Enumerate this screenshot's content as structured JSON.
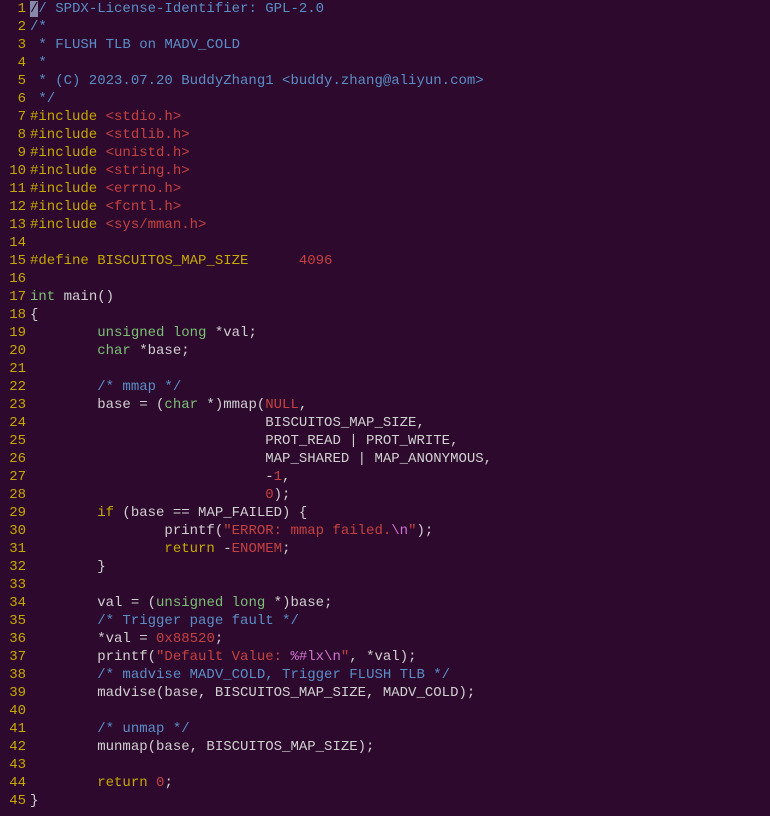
{
  "lines": [
    {
      "n": "1",
      "segs": [
        {
          "cls": "cursor",
          "t": "/"
        },
        {
          "cls": "comment",
          "t": "/ SPDX-License-Identifier: GPL-2.0"
        }
      ]
    },
    {
      "n": "2",
      "segs": [
        {
          "cls": "comment",
          "t": "/*"
        }
      ]
    },
    {
      "n": "3",
      "segs": [
        {
          "cls": "comment",
          "t": " * FLUSH TLB on MADV_COLD"
        }
      ]
    },
    {
      "n": "4",
      "segs": [
        {
          "cls": "comment",
          "t": " *"
        }
      ]
    },
    {
      "n": "5",
      "segs": [
        {
          "cls": "comment",
          "t": " * (C) 2023.07.20 BuddyZhang1 <buddy.zhang@aliyun.com>"
        }
      ]
    },
    {
      "n": "6",
      "segs": [
        {
          "cls": "comment",
          "t": " */"
        }
      ]
    },
    {
      "n": "7",
      "segs": [
        {
          "cls": "keyword",
          "t": "#include "
        },
        {
          "cls": "string",
          "t": "<stdio.h>"
        }
      ]
    },
    {
      "n": "8",
      "segs": [
        {
          "cls": "keyword",
          "t": "#include "
        },
        {
          "cls": "string",
          "t": "<stdlib.h>"
        }
      ]
    },
    {
      "n": "9",
      "segs": [
        {
          "cls": "keyword",
          "t": "#include "
        },
        {
          "cls": "string",
          "t": "<unistd.h>"
        }
      ]
    },
    {
      "n": "10",
      "segs": [
        {
          "cls": "keyword",
          "t": "#include "
        },
        {
          "cls": "string",
          "t": "<string.h>"
        }
      ]
    },
    {
      "n": "11",
      "segs": [
        {
          "cls": "keyword",
          "t": "#include "
        },
        {
          "cls": "string",
          "t": "<errno.h>"
        }
      ]
    },
    {
      "n": "12",
      "segs": [
        {
          "cls": "keyword",
          "t": "#include "
        },
        {
          "cls": "string",
          "t": "<fcntl.h>"
        }
      ]
    },
    {
      "n": "13",
      "segs": [
        {
          "cls": "keyword",
          "t": "#include "
        },
        {
          "cls": "string",
          "t": "<sys/mman.h>"
        }
      ]
    },
    {
      "n": "14",
      "segs": [
        {
          "cls": "",
          "t": ""
        }
      ]
    },
    {
      "n": "15",
      "segs": [
        {
          "cls": "keyword",
          "t": "#define BISCUITOS_MAP_SIZE      "
        },
        {
          "cls": "number",
          "t": "4096"
        }
      ]
    },
    {
      "n": "16",
      "segs": [
        {
          "cls": "",
          "t": ""
        }
      ]
    },
    {
      "n": "17",
      "segs": [
        {
          "cls": "type",
          "t": "int"
        },
        {
          "cls": "ident",
          "t": " main()"
        }
      ]
    },
    {
      "n": "18",
      "segs": [
        {
          "cls": "ident",
          "t": "{"
        }
      ]
    },
    {
      "n": "19",
      "segs": [
        {
          "cls": "ident",
          "t": "        "
        },
        {
          "cls": "type",
          "t": "unsigned"
        },
        {
          "cls": "ident",
          "t": " "
        },
        {
          "cls": "type",
          "t": "long"
        },
        {
          "cls": "ident",
          "t": " *val;"
        }
      ]
    },
    {
      "n": "20",
      "segs": [
        {
          "cls": "ident",
          "t": "        "
        },
        {
          "cls": "type",
          "t": "char"
        },
        {
          "cls": "ident",
          "t": " *base;"
        }
      ]
    },
    {
      "n": "21",
      "segs": [
        {
          "cls": "",
          "t": ""
        }
      ]
    },
    {
      "n": "22",
      "segs": [
        {
          "cls": "ident",
          "t": "        "
        },
        {
          "cls": "comment",
          "t": "/* mmap */"
        }
      ]
    },
    {
      "n": "23",
      "segs": [
        {
          "cls": "ident",
          "t": "        base = ("
        },
        {
          "cls": "type",
          "t": "char"
        },
        {
          "cls": "ident",
          "t": " *)mmap("
        },
        {
          "cls": "number",
          "t": "NULL"
        },
        {
          "cls": "ident",
          "t": ","
        }
      ]
    },
    {
      "n": "24",
      "segs": [
        {
          "cls": "ident",
          "t": "                            BISCUITOS_MAP_SIZE,"
        }
      ]
    },
    {
      "n": "25",
      "segs": [
        {
          "cls": "ident",
          "t": "                            PROT_READ | PROT_WRITE,"
        }
      ]
    },
    {
      "n": "26",
      "segs": [
        {
          "cls": "ident",
          "t": "                            MAP_SHARED | MAP_ANONYMOUS,"
        }
      ]
    },
    {
      "n": "27",
      "segs": [
        {
          "cls": "ident",
          "t": "                            -"
        },
        {
          "cls": "number",
          "t": "1"
        },
        {
          "cls": "ident",
          "t": ","
        }
      ]
    },
    {
      "n": "28",
      "segs": [
        {
          "cls": "ident",
          "t": "                            "
        },
        {
          "cls": "number",
          "t": "0"
        },
        {
          "cls": "ident",
          "t": ");"
        }
      ]
    },
    {
      "n": "29",
      "segs": [
        {
          "cls": "ident",
          "t": "        "
        },
        {
          "cls": "keyword",
          "t": "if"
        },
        {
          "cls": "ident",
          "t": " (base == MAP_FAILED) {"
        }
      ]
    },
    {
      "n": "30",
      "segs": [
        {
          "cls": "ident",
          "t": "                printf("
        },
        {
          "cls": "string",
          "t": "\"ERROR: mmap failed."
        },
        {
          "cls": "escape",
          "t": "\\n"
        },
        {
          "cls": "string",
          "t": "\""
        },
        {
          "cls": "ident",
          "t": ");"
        }
      ]
    },
    {
      "n": "31",
      "segs": [
        {
          "cls": "ident",
          "t": "                "
        },
        {
          "cls": "keyword",
          "t": "return"
        },
        {
          "cls": "ident",
          "t": " -"
        },
        {
          "cls": "number",
          "t": "ENOMEM"
        },
        {
          "cls": "ident",
          "t": ";"
        }
      ]
    },
    {
      "n": "32",
      "segs": [
        {
          "cls": "ident",
          "t": "        }"
        }
      ]
    },
    {
      "n": "33",
      "segs": [
        {
          "cls": "",
          "t": ""
        }
      ]
    },
    {
      "n": "34",
      "segs": [
        {
          "cls": "ident",
          "t": "        val = ("
        },
        {
          "cls": "type",
          "t": "unsigned"
        },
        {
          "cls": "ident",
          "t": " "
        },
        {
          "cls": "type",
          "t": "long"
        },
        {
          "cls": "ident",
          "t": " *)base;"
        }
      ]
    },
    {
      "n": "35",
      "segs": [
        {
          "cls": "ident",
          "t": "        "
        },
        {
          "cls": "comment",
          "t": "/* Trigger page fault */"
        }
      ]
    },
    {
      "n": "36",
      "segs": [
        {
          "cls": "ident",
          "t": "        *val = "
        },
        {
          "cls": "number",
          "t": "0x88520"
        },
        {
          "cls": "ident",
          "t": ";"
        }
      ]
    },
    {
      "n": "37",
      "segs": [
        {
          "cls": "ident",
          "t": "        printf("
        },
        {
          "cls": "string",
          "t": "\"Default Value: "
        },
        {
          "cls": "escape",
          "t": "%#lx\\n"
        },
        {
          "cls": "string",
          "t": "\""
        },
        {
          "cls": "ident",
          "t": ", *val);"
        }
      ]
    },
    {
      "n": "38",
      "segs": [
        {
          "cls": "ident",
          "t": "        "
        },
        {
          "cls": "comment",
          "t": "/* madvise MADV_COLD, Trigger FLUSH TLB */"
        }
      ]
    },
    {
      "n": "39",
      "segs": [
        {
          "cls": "ident",
          "t": "        madvise(base, BISCUITOS_MAP_SIZE, MADV_COLD);"
        }
      ]
    },
    {
      "n": "40",
      "segs": [
        {
          "cls": "",
          "t": ""
        }
      ]
    },
    {
      "n": "41",
      "segs": [
        {
          "cls": "ident",
          "t": "        "
        },
        {
          "cls": "comment",
          "t": "/* unmap */"
        }
      ]
    },
    {
      "n": "42",
      "segs": [
        {
          "cls": "ident",
          "t": "        munmap(base, BISCUITOS_MAP_SIZE);"
        }
      ]
    },
    {
      "n": "43",
      "segs": [
        {
          "cls": "",
          "t": ""
        }
      ]
    },
    {
      "n": "44",
      "segs": [
        {
          "cls": "ident",
          "t": "        "
        },
        {
          "cls": "keyword",
          "t": "return"
        },
        {
          "cls": "ident",
          "t": " "
        },
        {
          "cls": "number",
          "t": "0"
        },
        {
          "cls": "ident",
          "t": ";"
        }
      ]
    },
    {
      "n": "45",
      "segs": [
        {
          "cls": "ident",
          "t": "}"
        }
      ]
    }
  ]
}
